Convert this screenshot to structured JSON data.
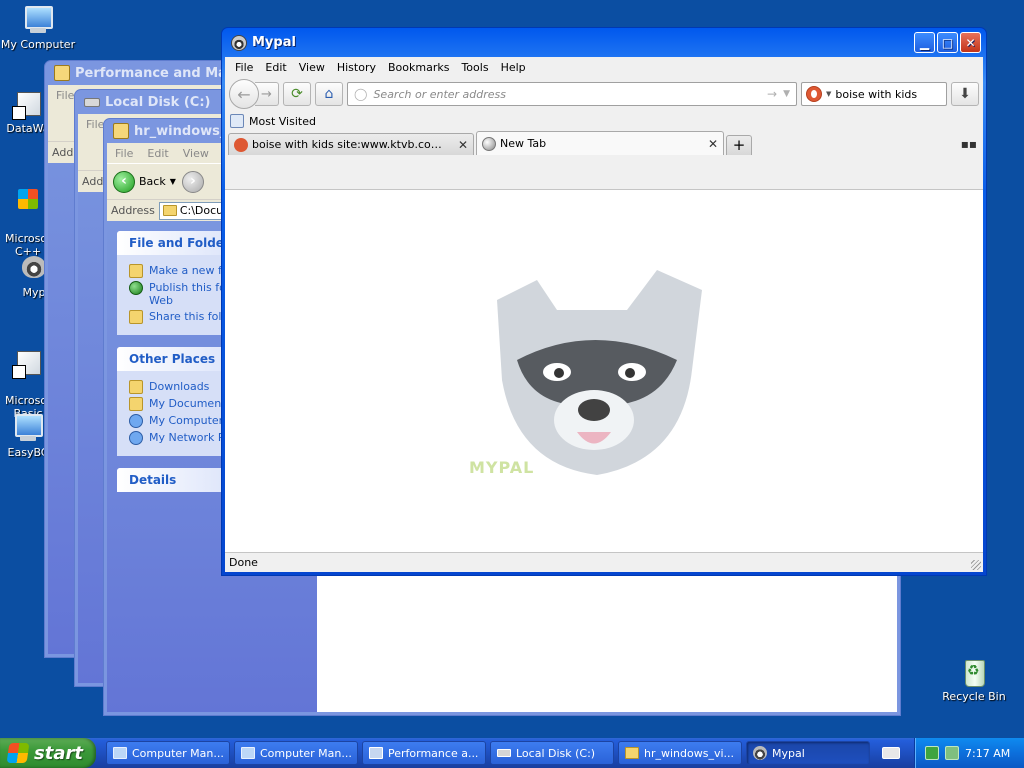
{
  "desktop": {
    "icons": [
      {
        "label": "My Computer",
        "icon": "my-computer-icon"
      },
      {
        "label": "DataWa",
        "icon": "app-shortcut-icon"
      },
      {
        "label": "Microsof\nC++",
        "icon": "ms-cpp-icon"
      },
      {
        "label": "Myp",
        "icon": "mypal-icon"
      },
      {
        "label": "Microsof\nBasic",
        "icon": "ms-basic-icon"
      },
      {
        "label": "EasyBC",
        "icon": "easybcd-icon"
      },
      {
        "label": "Recycle Bin",
        "icon": "recycle-bin-icon"
      }
    ]
  },
  "windows": {
    "perf": {
      "title": "Performance and Mainte",
      "menu_first": "File",
      "address_label": "Add"
    },
    "disk": {
      "title": "Local Disk (C:)",
      "menu_first": "File",
      "address_label": "Add"
    },
    "hr": {
      "title": "hr_windows_vi",
      "menu": [
        "File",
        "Edit",
        "View"
      ],
      "back_label": "Back",
      "address_label": "Address",
      "address_value": "C:\\Docum",
      "tasks_header": "File and Folder T",
      "tasks": [
        "Make a new fo",
        "Publish this fo\nWeb",
        "Share this fold"
      ],
      "places_header": "Other Places",
      "places": [
        "Downloads",
        "My Document",
        "My Computer",
        "My Network P"
      ],
      "details_header": "Details"
    }
  },
  "browser": {
    "title": "Mypal",
    "menu": [
      "File",
      "Edit",
      "View",
      "History",
      "Bookmarks",
      "Tools",
      "Help"
    ],
    "url_placeholder": "Search or enter address",
    "search_value": "boise with kids",
    "bookmarks_bar": "Most Visited",
    "tabs": [
      {
        "label": "boise with kids site:www.ktvb.com at Du..."
      },
      {
        "label": "New Tab"
      }
    ],
    "wordmark": "MYPAL",
    "status": "Done"
  },
  "taskbar": {
    "start_label": "start",
    "buttons": [
      {
        "label": "Computer Man..."
      },
      {
        "label": "Computer Man..."
      },
      {
        "label": "Performance a..."
      },
      {
        "label": "Local Disk (C:)"
      },
      {
        "label": "hr_windows_vi..."
      },
      {
        "label": "Mypal"
      }
    ],
    "clock": "7:17 AM"
  },
  "colors": {
    "desktop": "#0b4ea2",
    "xp_title_active": "#0a5ee8",
    "xp_title_inactive": "#7b96e0",
    "taskpane_link": "#215dc6",
    "start_green": "#3c9a3a"
  }
}
